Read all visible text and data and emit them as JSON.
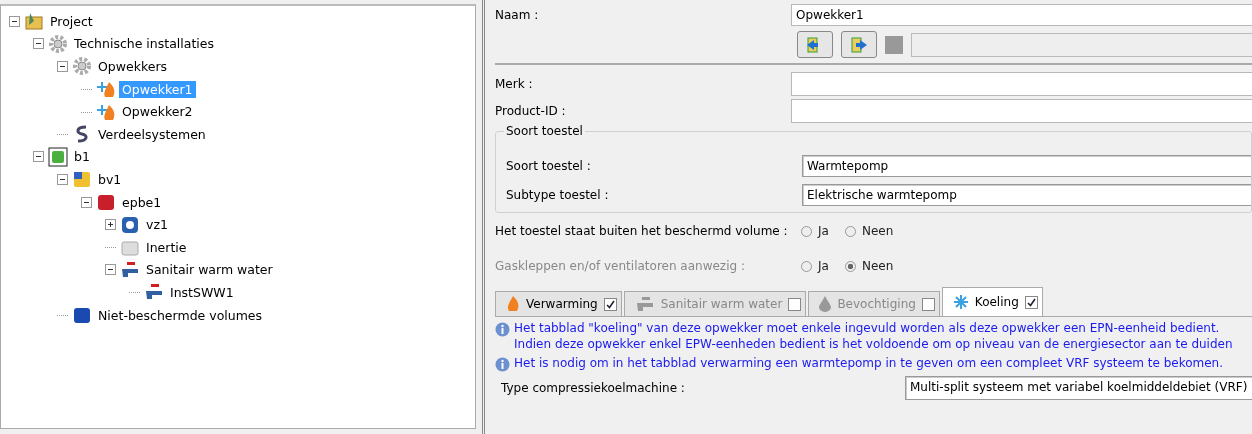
{
  "tree": [
    {
      "label": "Project",
      "kind": "project",
      "expanded": true,
      "selected": false,
      "children": [
        {
          "label": "Technische installaties",
          "kind": "gear",
          "expanded": true,
          "selected": false,
          "children": [
            {
              "label": "Opwekkers",
              "kind": "gear",
              "expanded": true,
              "selected": false,
              "children": [
                {
                  "label": "Opwekker1",
                  "kind": "generator",
                  "selected": true
                },
                {
                  "label": "Opwekker2",
                  "kind": "generator",
                  "selected": false
                }
              ]
            },
            {
              "label": "Verdeelsystemen",
              "kind": "distribution",
              "selected": false
            }
          ]
        },
        {
          "label": "b1",
          "kind": "building",
          "expanded": true,
          "selected": false,
          "children": [
            {
              "label": "bv1",
              "kind": "volume",
              "expanded": true,
              "selected": false,
              "children": [
                {
                  "label": "epbe1",
                  "kind": "unit",
                  "expanded": true,
                  "selected": false,
                  "children": [
                    {
                      "label": "vz1",
                      "kind": "fan",
                      "expanded": false,
                      "selected": false
                    },
                    {
                      "label": "Inertie",
                      "kind": "inertia",
                      "selected": false
                    },
                    {
                      "label": "Sanitair warm water",
                      "kind": "tap",
                      "expanded": true,
                      "selected": false,
                      "children": [
                        {
                          "label": "InstSWW1",
                          "kind": "tap",
                          "selected": false
                        }
                      ]
                    }
                  ]
                }
              ]
            },
            {
              "label": "Niet-beschermde volumes",
              "kind": "bluecube",
              "selected": false
            }
          ]
        }
      ]
    }
  ],
  "form": {
    "name_label": "Naam :",
    "name_value": "Opwekker1",
    "brand_label": "Merk :",
    "product_label": "Product-ID :",
    "group_title": "Soort toestel",
    "type_label": "Soort toestel :",
    "type_value": "Warmtepomp",
    "subtype_label": "Subtype toestel :",
    "subtype_value": "Elektrische warmtepomp",
    "questions": [
      {
        "label": "Het toestel staat buiten het beschermd volume :",
        "disabled": false,
        "options": [
          {
            "label": "Ja",
            "selected": false
          },
          {
            "label": "Neen",
            "selected": false
          }
        ]
      },
      {
        "label": "Gaskleppen en/of ventilatoren aanwezig :",
        "disabled": true,
        "options": [
          {
            "label": "Ja",
            "selected": false
          },
          {
            "label": "Neen",
            "selected": true
          }
        ]
      }
    ]
  },
  "tabs": [
    {
      "label": "Verwarming",
      "kind": "flame",
      "checked": true,
      "disabled": false,
      "selected": false
    },
    {
      "label": "Sanitair warm water",
      "kind": "tap",
      "checked": false,
      "disabled": true,
      "selected": false
    },
    {
      "label": "Bevochtiging",
      "kind": "drop",
      "checked": false,
      "disabled": true,
      "selected": false
    },
    {
      "label": "Koeling",
      "kind": "snow",
      "checked": true,
      "disabled": false,
      "selected": true
    }
  ],
  "info": [
    {
      "lines": [
        "Het tabblad \"koeling\" van deze opwekker moet enkele ingevuld worden als deze opwekker een EPN-eenheid bedient.",
        "Indien deze opwekker enkel EPW-eenheden bedient is het voldoende om op niveau van de energiesector aan te duiden"
      ]
    },
    {
      "lines": [
        "Het is nodig om in het tabblad verwarming een warmtepomp in te geven om een compleet VRF systeem te bekomen."
      ]
    }
  ],
  "compressor": {
    "label": "Type compressiekoelmachine :",
    "value": "Multi-split systeem met variabel koelmiddeldebiet (VRF)"
  }
}
